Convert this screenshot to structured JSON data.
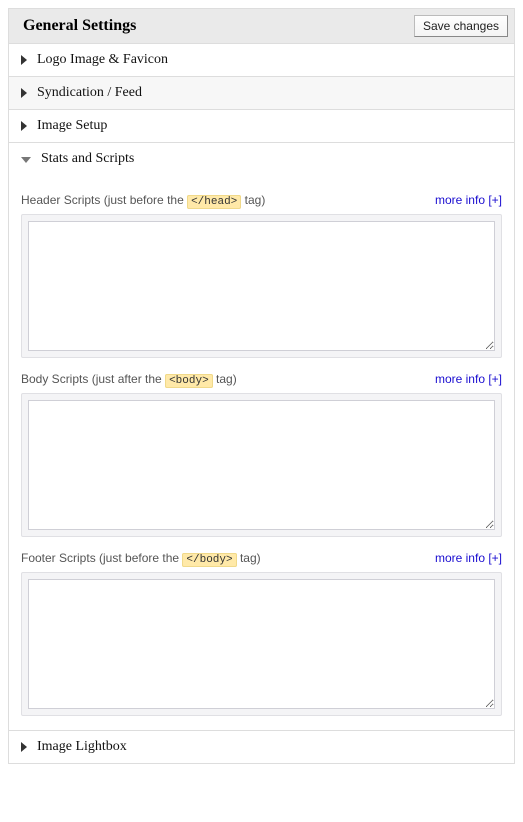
{
  "panel": {
    "title": "General Settings",
    "save_label": "Save changes"
  },
  "sections": {
    "logo": "Logo Image & Favicon",
    "syndication": "Syndication / Feed",
    "image_setup": "Image Setup",
    "stats_scripts": "Stats and Scripts",
    "image_lightbox": "Image Lightbox"
  },
  "more_info_label": "more info [+]",
  "fields": {
    "header": {
      "pre": "Header Scripts (just before the ",
      "code": "</head>",
      "post": " tag)",
      "value": ""
    },
    "body": {
      "pre": "Body Scripts (just after the ",
      "code": "<body>",
      "post": " tag)",
      "value": ""
    },
    "footer": {
      "pre": "Footer Scripts (just before the ",
      "code": "</body>",
      "post": " tag)",
      "value": ""
    }
  }
}
